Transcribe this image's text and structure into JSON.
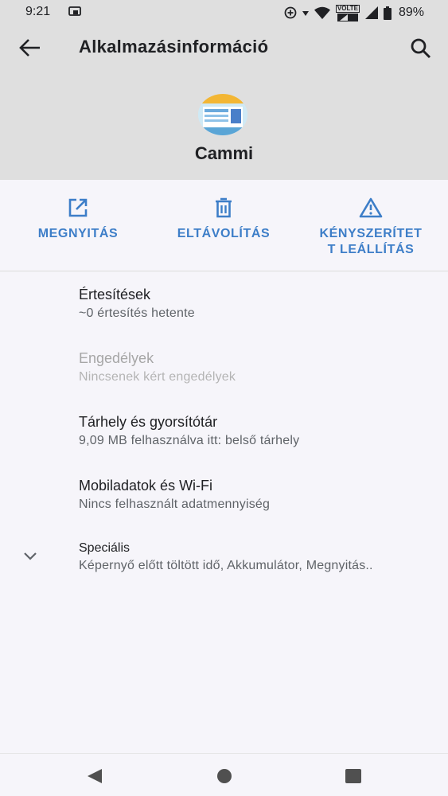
{
  "status_bar": {
    "time": "9:21",
    "network_badge": "VOLTE",
    "battery": "89%"
  },
  "app_bar": {
    "title": "Alkalmazásinformáció",
    "back_icon": "arrow-back-icon",
    "search_icon": "search-icon"
  },
  "app": {
    "name": "Cammi",
    "icon": "cammi-app-icon"
  },
  "actions": [
    {
      "label": "MEGNYITÁS",
      "icon": "open-external-icon"
    },
    {
      "label": "ELTÁVOLÍTÁS",
      "icon": "trash-icon"
    },
    {
      "label_line1": "KÉNYSZERÍTET",
      "label_line2": "T LEÁLLÍTÁS",
      "icon": "warning-icon"
    }
  ],
  "items": [
    {
      "title": "Értesítések",
      "subtitle": "~0 értesítés hetente"
    },
    {
      "title": "Engedélyek",
      "subtitle": "Nincsenek kért engedélyek",
      "disabled": true
    },
    {
      "title": "Tárhely és gyorsítótár",
      "subtitle": "9,09 MB felhasználva itt: belső tárhely"
    },
    {
      "title": "Mobiladatok és Wi-Fi",
      "subtitle": "Nincs felhasznált adatmennyiség"
    },
    {
      "title": "Speciális",
      "subtitle": "Képernyő előtt töltött idő, Akkumulátor, Megnyitás..",
      "icon": "chevron-down-icon"
    }
  ],
  "colors": {
    "accent": "#3d7ec8",
    "header_bg": "#dfdfdf",
    "page_bg": "#f6f5fa"
  }
}
